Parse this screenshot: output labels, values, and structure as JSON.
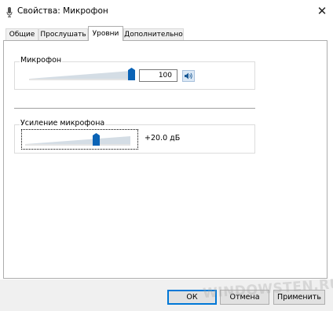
{
  "window": {
    "title": "Свойства: Микрофон",
    "close_symbol": "✕",
    "icon": "microphone-icon"
  },
  "tabs": [
    {
      "label": "Общие",
      "active": false
    },
    {
      "label": "Прослушать",
      "active": false
    },
    {
      "label": "Уровни",
      "active": true
    },
    {
      "label": "Дополнительно",
      "active": false
    }
  ],
  "microphone": {
    "label": "Микрофон",
    "value": "100",
    "level_fraction": 1.0,
    "mute_icon": "speaker-icon"
  },
  "boost": {
    "label": "Усиление микрофона",
    "value": "+20.0 дБ",
    "level_fraction": 0.67
  },
  "buttons": {
    "ok": "ОК",
    "cancel": "Отмена",
    "apply": "Применить"
  },
  "watermark": "WINDOWSTEN.RU",
  "colors": {
    "accent": "#0078d7",
    "thumb": "#0a63b6",
    "wedge": "#c8d4de"
  }
}
